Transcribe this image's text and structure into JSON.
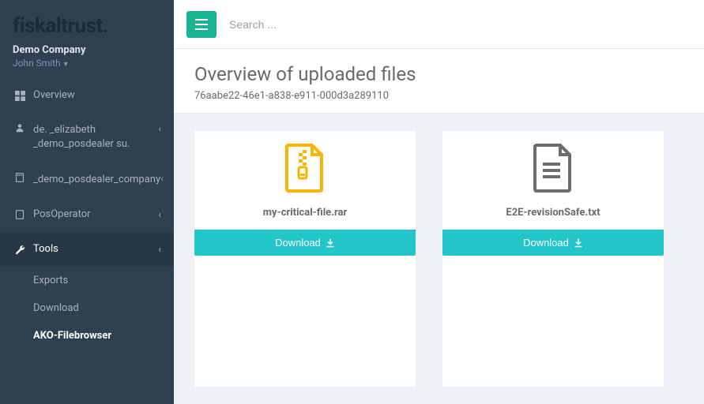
{
  "brand": "fiskaltrust.",
  "company": "Demo Company",
  "user": "John Smith",
  "search_placeholder": "Search ...",
  "page_title": "Overview of uploaded files",
  "page_subtitle": "76aabe22-46e1-a838-e911-000d3a289110",
  "nav": {
    "overview": "Overview",
    "item1": "de. _elizabeth _demo_posdealer su.",
    "item2": "_demo_posdealer_company",
    "item3": "PosOperator",
    "tools": "Tools",
    "exports": "Exports",
    "download": "Download",
    "ako": "AKO-Filebrowser"
  },
  "files": [
    {
      "name": "my-critical-file.rar",
      "type": "archive",
      "action": "Download"
    },
    {
      "name": "E2E-revisionSafe.txt",
      "type": "text",
      "action": "Download"
    }
  ]
}
